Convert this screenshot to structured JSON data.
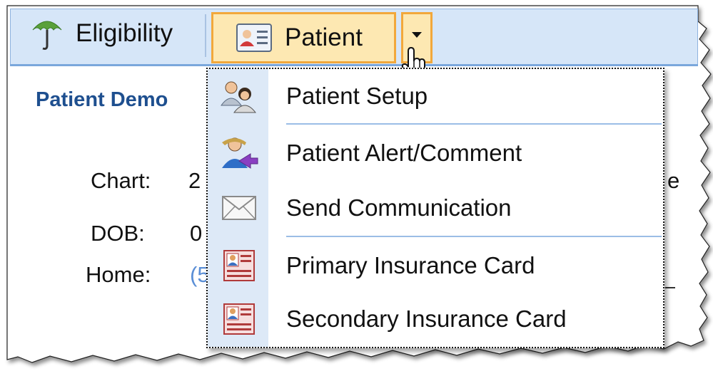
{
  "toolbar": {
    "eligibility_label": "Eligibility",
    "patient_label": "Patient"
  },
  "demographics": {
    "section_title": "Patient Demo",
    "fields": [
      {
        "label": "Chart:",
        "value": "2"
      },
      {
        "label": "DOB:",
        "value": "0"
      },
      {
        "label": "Home:",
        "value": "(5"
      }
    ],
    "right_edge_fragment": "e"
  },
  "menu": {
    "items": [
      {
        "label": "Patient Setup",
        "icon": "patient-setup-icon"
      },
      {
        "label": "Patient Alert/Comment",
        "icon": "patient-alert-icon"
      },
      {
        "label": "Send Communication",
        "icon": "envelope-icon"
      },
      {
        "label": "Primary Insurance Card",
        "icon": "insurance-card-icon"
      },
      {
        "label": "Secondary Insurance Card",
        "icon": "insurance-card-icon"
      }
    ]
  },
  "colors": {
    "toolbar_bg": "#d6e6f8",
    "button_highlight_bg": "#fde8b2",
    "button_highlight_border": "#f2a83b",
    "section_title": "#1e4f8f",
    "link_value": "#5b8fd6",
    "menu_icon_strip": "#dde9f7"
  }
}
